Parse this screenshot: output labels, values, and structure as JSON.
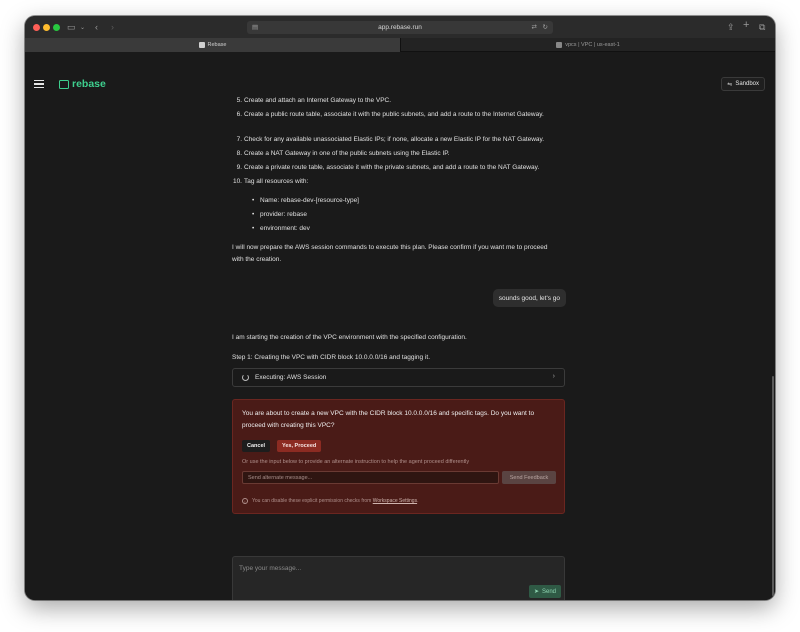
{
  "browser": {
    "url": "app.rebase.run",
    "tabs": [
      {
        "label": "Rebase",
        "active": true
      },
      {
        "label": "vpcs | VPC | us-east-1",
        "active": false
      }
    ]
  },
  "app": {
    "logo_text": "rebase",
    "sandbox_label": "Sandbox"
  },
  "conversation": {
    "steps": [
      {
        "num": "5.",
        "text": "Create and attach an Internet Gateway to the VPC."
      },
      {
        "num": "6.",
        "text": "Create a public route table, associate it with the public subnets, and add a route to the Internet Gateway."
      },
      {
        "num": "7.",
        "text": "Check for any available unassociated Elastic IPs; if none, allocate a new Elastic IP for the NAT Gateway."
      },
      {
        "num": "8.",
        "text": "Create a NAT Gateway in one of the public subnets using the Elastic IP."
      },
      {
        "num": "9.",
        "text": "Create a private route table, associate it with the private subnets, and add a route to the NAT Gateway."
      },
      {
        "num": "10.",
        "text": "Tag all resources with:"
      }
    ],
    "tags": [
      "Name: rebase-dev-[resource-type]",
      "provider: rebase",
      "environment: dev"
    ],
    "confirm_text": "I will now prepare the AWS session commands to execute this plan. Please confirm if you want me to proceed with the creation.",
    "user_message": "sounds good, let's go",
    "starting_text": "I am starting the creation of the VPC environment with the specified configuration.",
    "step1_text": "Step 1: Creating the VPC with CIDR block 10.0.0.0/16 and tagging it.",
    "executing_label": "Executing: AWS Session"
  },
  "permission": {
    "message": "You are about to create a new VPC with the CIDR block 10.0.0.0/16 and specific tags. Do you want to proceed with creating this VPC?",
    "cancel_label": "Cancel",
    "proceed_label": "Yes, Proceed",
    "hint": "Or use the input below to provide an alternate instruction to help the agent proceed differently",
    "alt_placeholder": "Send alternate message...",
    "feedback_label": "Send Feedback",
    "note_prefix": "You can disable these explicit permission checks from",
    "note_link": "Workspace Settings",
    "note_suffix": "."
  },
  "composer": {
    "placeholder": "Type your message...",
    "send_label": "Send"
  }
}
